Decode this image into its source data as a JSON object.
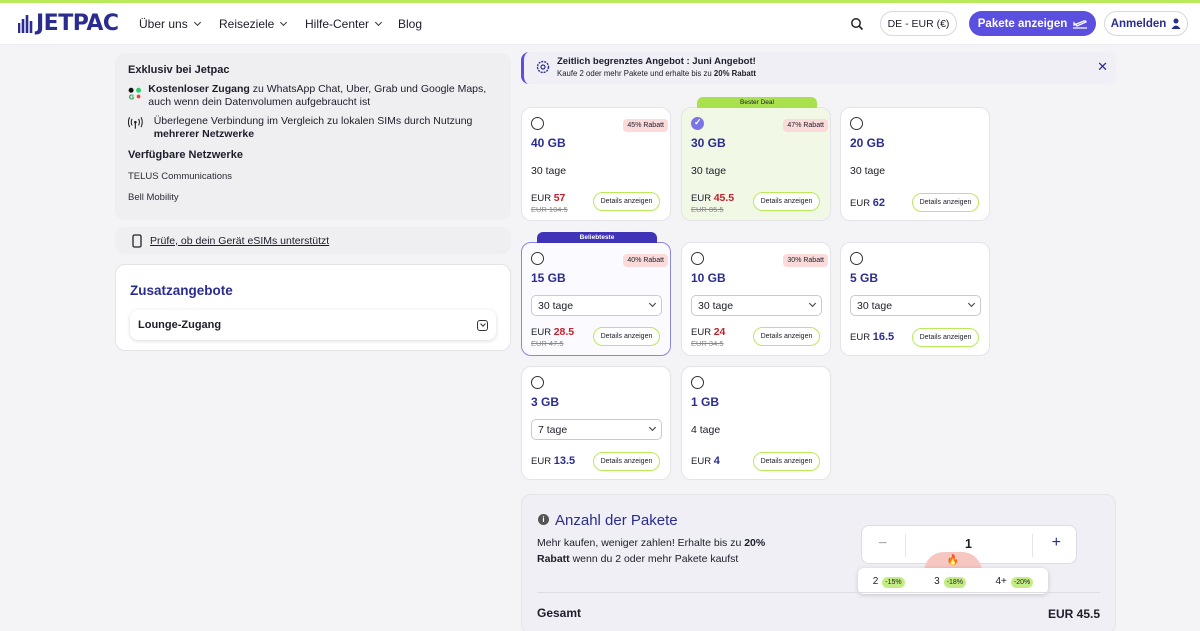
{
  "header": {
    "logo": "JETPAC",
    "nav": [
      "Über uns",
      "Reiseziele",
      "Hilfe-Center",
      "Blog"
    ],
    "lang": "DE - EUR (€)",
    "cta": "Pakete anzeigen",
    "login": "Anmelden"
  },
  "exclusive": {
    "title": "Exklusiv bei Jetpac",
    "free_bold": "Kostenloser Zugang",
    "free_rest": " zu WhatsApp Chat, Uber, Grab und Google Maps, auch wenn dein Datenvolumen aufgebraucht ist",
    "network_text": "Überlegene Verbindung im Vergleich zu lokalen SIMs durch Nutzung ",
    "network_bold": "mehrerer Netzwerke",
    "networks_title": "Verfügbare Netzwerke",
    "networks": [
      "TELUS Communications",
      "Bell Mobility"
    ]
  },
  "esim_check": "Prüfe, ob dein Gerät eSIMs unterstützt",
  "addons": {
    "title": "Zusatzangebote",
    "lounge": "Lounge-Zugang"
  },
  "promo": {
    "title": "Zeitlich begrenztes Angebot : Juni Angebot!",
    "text": "Kaufe 2 oder mehr Pakete und erhalte bis zu ",
    "text_bold": "20% Rabatt"
  },
  "details_label": "Details anzeigen",
  "currency": "EUR",
  "plans": [
    {
      "gb": "40 GB",
      "discount": "45% Rabatt",
      "days": "30 tage",
      "price": "57",
      "old": "EUR 104.5"
    },
    {
      "gb": "30 GB",
      "discount": "47% Rabatt",
      "days": "30 tage",
      "price": "45.5",
      "old": "EUR 85.5",
      "ribbon": "Bester Deal"
    },
    {
      "gb": "20 GB",
      "days": "30 tage",
      "price": "62"
    },
    {
      "gb": "15 GB",
      "discount": "40% Rabatt",
      "days": "30 tage",
      "price": "28.5",
      "old": "EUR 47.5",
      "ribbon": "Beliebteste"
    },
    {
      "gb": "10 GB",
      "discount": "30% Rabatt",
      "days": "30 tage",
      "price": "24",
      "old": "EUR 34.5"
    },
    {
      "gb": "5 GB",
      "days": "30 tage",
      "price": "16.5"
    },
    {
      "gb": "3 GB",
      "days": "7 tage",
      "price": "13.5"
    },
    {
      "gb": "1 GB",
      "days": "4 tage",
      "price": "4"
    }
  ],
  "quantity": {
    "title": "Anzahl der Pakete",
    "desc_a": "Mehr kaufen, weniger zahlen! Erhalte bis zu ",
    "desc_bold": "20% Rabatt",
    "desc_b": " wenn du 2 oder mehr Pakete kaufst",
    "value": "1",
    "fire": "🔥",
    "tiers": [
      {
        "n": "2",
        "d": "-15%"
      },
      {
        "n": "3",
        "d": "-18%"
      },
      {
        "n": "4+",
        "d": "-20%"
      }
    ],
    "total_label": "Gesamt",
    "total_value": "EUR 45.5"
  }
}
